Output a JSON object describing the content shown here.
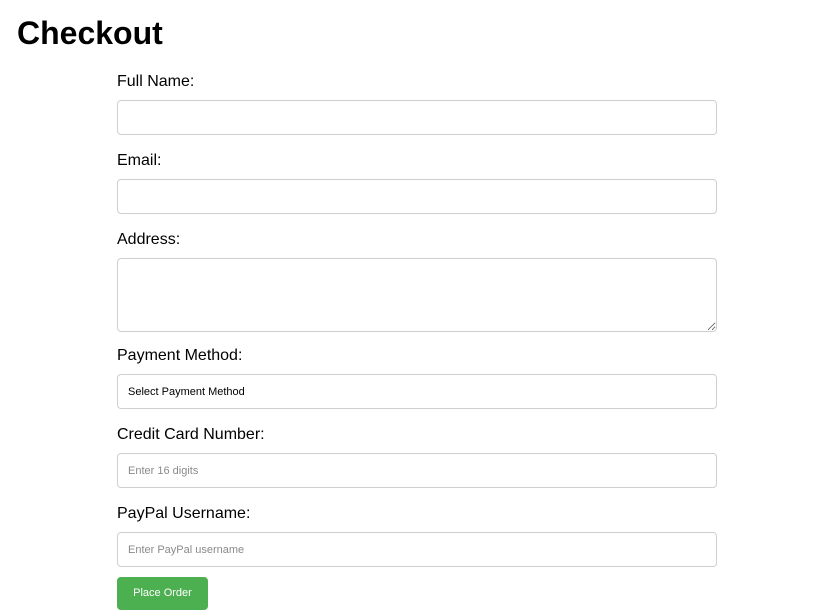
{
  "page": {
    "title": "Checkout"
  },
  "form": {
    "full_name": {
      "label": "Full Name:",
      "value": ""
    },
    "email": {
      "label": "Email:",
      "value": ""
    },
    "address": {
      "label": "Address:",
      "value": ""
    },
    "payment_method": {
      "label": "Payment Method:",
      "selected": "Select Payment Method"
    },
    "credit_card": {
      "label": "Credit Card Number:",
      "placeholder": "Enter 16 digits"
    },
    "paypal": {
      "label": "PayPal Username:",
      "placeholder": "Enter PayPal username"
    },
    "submit_label": "Place Order"
  },
  "colors": {
    "accent": "#4caf50",
    "input_border": "#cfcfcf"
  }
}
